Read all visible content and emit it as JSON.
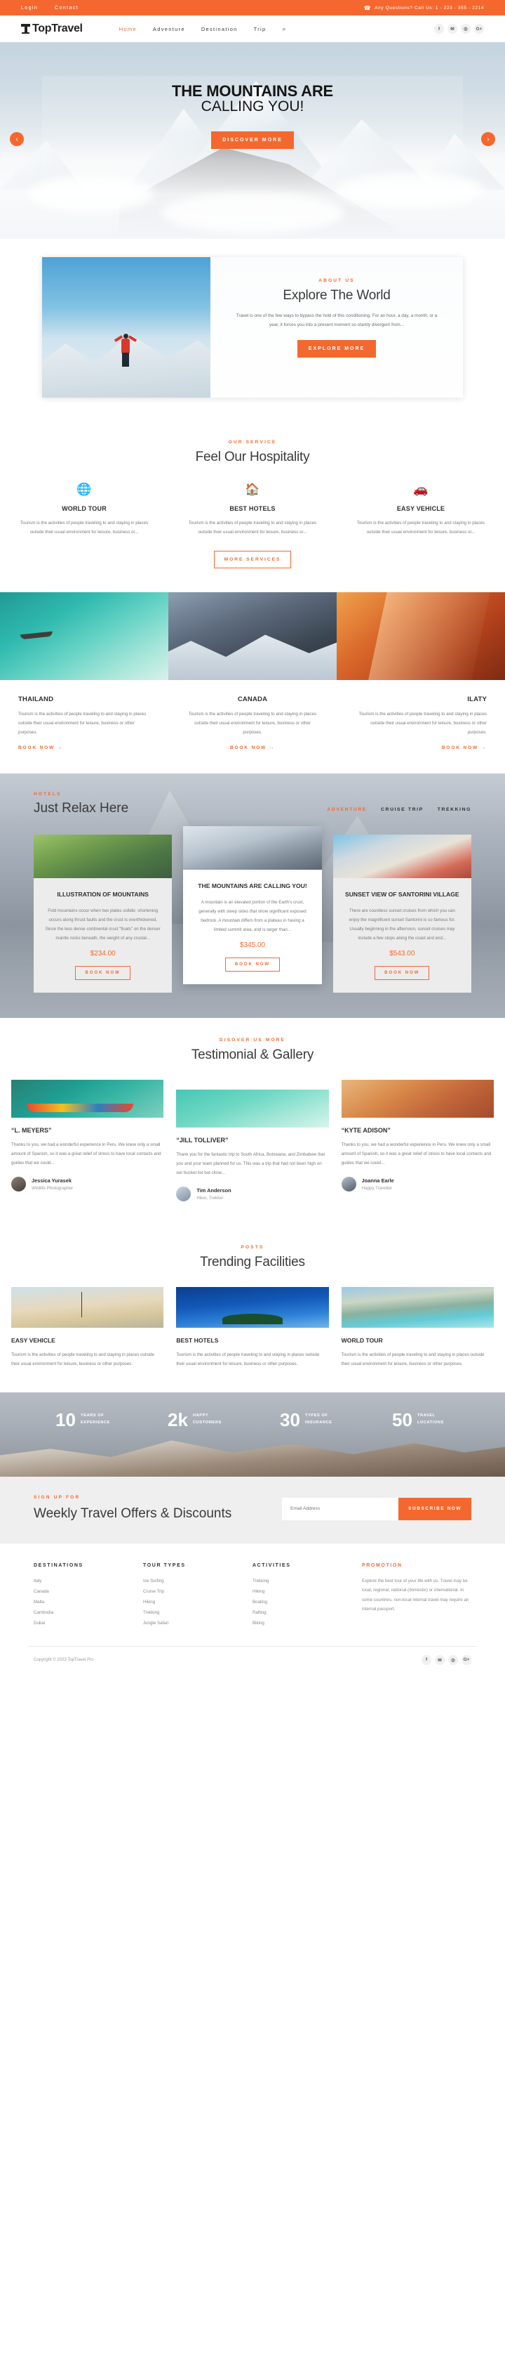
{
  "topbar": {
    "login": "Login",
    "contact": "Contact",
    "phone_icon": "phone-icon",
    "phone_text": "Any Questions? Call Us: 1 - 223 - 355 - 2214"
  },
  "header": {
    "logo": "TopTravel",
    "nav": [
      {
        "label": "Home",
        "active": true
      },
      {
        "label": "Adventure",
        "active": false
      },
      {
        "label": "Destination",
        "active": false
      },
      {
        "label": "Trip",
        "active": false
      }
    ],
    "search_icon": "search-icon",
    "socials": [
      "f",
      "✉",
      "◎",
      "G+"
    ]
  },
  "hero": {
    "title_line1": "THE MOUNTAINS ARE",
    "title_line2": "CALLING YOU!",
    "cta": "DISCOVER MORE",
    "prev_icon": "chevron-left-icon",
    "next_icon": "chevron-right-icon"
  },
  "about": {
    "eyebrow": "ABOUT US",
    "title": "Explore The World",
    "text": "Travel is one of the few ways to bypass the hold of this conditioning. For an hour, a day, a month, or a year, it forces you into a present moment so starkly divergent from...",
    "cta": "EXPLORE MORE"
  },
  "services": {
    "eyebrow": "OUR SERVICE",
    "title": "Feel Our Hospitality",
    "items": [
      {
        "icon": "globe-icon",
        "glyph": "🌐",
        "title": "WORLD TOUR",
        "text": "Tourism is the activities of people traveling to and staying in places outside their usual environment for leisure, business or..."
      },
      {
        "icon": "home-icon",
        "glyph": "⌂",
        "title": "BEST HOTELS",
        "text": "Tourism is the activities of people traveling to and staying in places outside their usual environment for leisure, business or..."
      },
      {
        "icon": "car-icon",
        "glyph": "🚗",
        "title": "EASY VEHICLE",
        "text": "Tourism is the activities of people traveling to and staying in places outside their usual environment for leisure, business or..."
      }
    ],
    "cta": "MORE SERVICES"
  },
  "destinations": [
    {
      "name": "THAILAND",
      "text": "Tourism is the activities of people traveling to and staying in places outside their usual environment for leisure, business or other purposes.",
      "link": "BOOK NOW →"
    },
    {
      "name": "CANADA",
      "text": "Tourism is the activities of people traveling to and staying in places outside their usual environment for leisure, business or other purposes.",
      "link": "BOOK NOW →"
    },
    {
      "name": "ILATY",
      "text": "Tourism is the activities of people traveling to and staying in places outside their usual environment for leisure, business or other purposes.",
      "link": "BOOK NOW →"
    }
  ],
  "hotels": {
    "eyebrow": "HOTELS",
    "title": "Just Relax Here",
    "tabs": [
      {
        "label": "ADVENTURE",
        "active": true
      },
      {
        "label": "CRUISE TRIP",
        "active": false
      },
      {
        "label": "TREKKING",
        "active": false
      }
    ],
    "cards": [
      {
        "title": "ILLUSTRATION OF MOUNTAINS",
        "text": "Fold mountains occur when two plates collide: shortening occurs along thrust faults and the crust is overthickened. Since the less dense continental crust “floats” on the denser mantle rocks beneath, the weight of any crustal...",
        "price": "$234.00",
        "cta": "BOOK NOW"
      },
      {
        "title": "THE MOUNTAINS ARE CALLING YOU!",
        "text": "A mountain is an elevated portion of the Earth’s crust, generally with steep sides that show significant exposed bedrock. A mountain differs from a plateau in having a limited summit area, and is larger than...",
        "price": "$345.00",
        "cta": "BOOK NOW"
      },
      {
        "title": "SUNSET VIEW OF SANTORINI VILLAGE",
        "text": "There are countless sunset cruises from which you can enjoy the magnificent sunset Santorini is so famous for. Usually beginning in the afternoon, sunset cruises may include a few stops along the coast and end...",
        "price": "$543.00",
        "cta": "BOOK NOW"
      }
    ]
  },
  "testimonial": {
    "eyebrow": "DISOVER US MORE",
    "title": "Testimonial & Gallery",
    "items": [
      {
        "quote": "“L. MEYERS”",
        "text": "Thanks to you, we had a wonderful experience in Peru. We knew only a small amount of Spanish, so it was a great relief of stress to have local contacts and guides that we could...",
        "name": "Jessica Yurasek",
        "role": "Wildlife Photographer"
      },
      {
        "quote": "“JILL TOLLIVER”",
        "text": "Thank you for the fantastic trip to South Africa, Botswana, and Zimbabwe that you and your team planned for us. This was a trip that had not been high on our bucket list but close...",
        "name": "Tim Anderson",
        "role": "Hiker, Trekker"
      },
      {
        "quote": "“KYTE ADISON”",
        "text": "Thanks to you, we had a wonderful experience in Peru. We knew only a small amount of Spanish, so it was a great relief of stress to have local contacts and guides that we could...",
        "name": "Joanna Earle",
        "role": "Happy Traveller"
      }
    ]
  },
  "posts": {
    "eyebrow": "POSTS",
    "title": "Trending Facilities",
    "items": [
      {
        "title": "EASY VEHICLE",
        "text": "Tourism is the activities of people traveling to and staying in places outside their usual environment for leisure, business or other purposes."
      },
      {
        "title": "BEST HOTELS",
        "text": "Tourism is the activities of people traveling to and staying in places outside their usual environment for leisure, business or other purposes."
      },
      {
        "title": "WORLD TOUR",
        "text": "Tourism is the activities of people traveling to and staying in places outside their usual environment for leisure, business or other purposes."
      }
    ]
  },
  "stats": [
    {
      "number": "10",
      "label": "YEARS OF EXPERIENCE"
    },
    {
      "number": "2k",
      "label": "HAPPY CUSTOMERS"
    },
    {
      "number": "30",
      "label": "TYPES OF INSURANCE"
    },
    {
      "number": "50",
      "label": "TRAVEL LOCATIONS"
    }
  ],
  "newsletter": {
    "eyebrow": "SIGN UP FOR",
    "title": "Weekly Travel Offers & Discounts",
    "placeholder": "Email Address",
    "button": "SUBSCRIBE NOW"
  },
  "footer": {
    "columns": [
      {
        "title": "DESTINATIONS",
        "items": [
          "Italy",
          "Canada",
          "Malta",
          "Cambodia",
          "Dubai"
        ]
      },
      {
        "title": "TOUR TYPES",
        "items": [
          "Ice Surfing",
          "Cruise Trip",
          "Hiking",
          "Trekking",
          "Jungle Safari"
        ]
      },
      {
        "title": "ACTIVITIES",
        "items": [
          "Trekking",
          "Hiking",
          "Boating",
          "Rafting",
          "Biking"
        ]
      }
    ],
    "promotion": {
      "title": "PROMOTION",
      "text": "Explore the best tour of your life with us. Travel may be local, regional, national (domestic) or international. In some countries, non-local internal travel may require an internal passport."
    },
    "copyright": "Copyright © 2023 TopTravel Pro",
    "socials": [
      "f",
      "✉",
      "◎",
      "G+"
    ]
  }
}
